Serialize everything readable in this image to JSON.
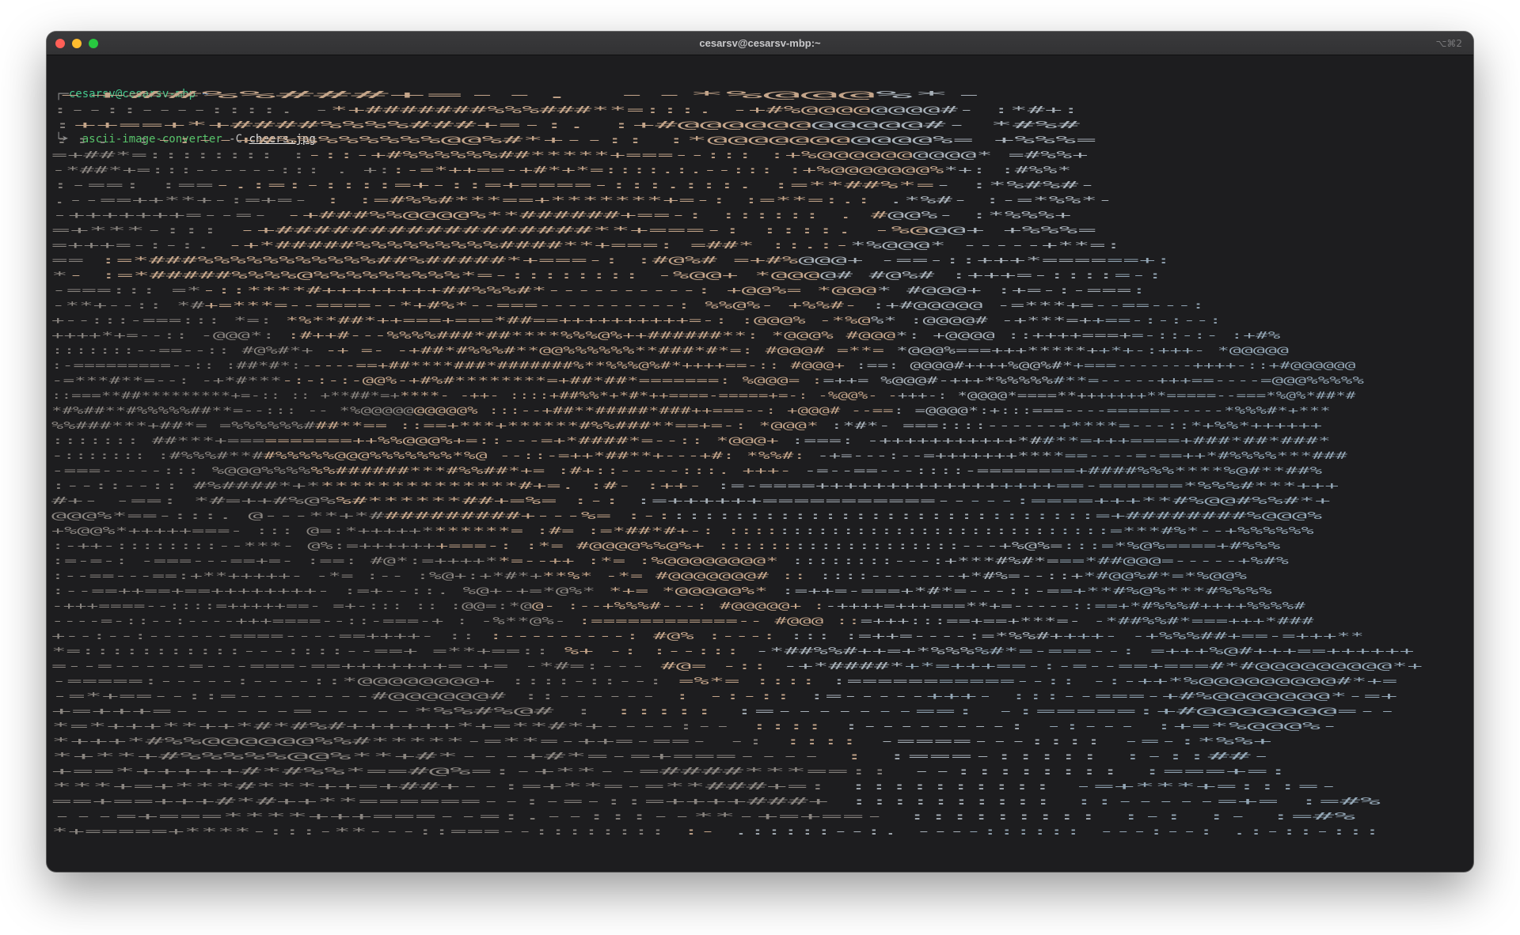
{
  "window": {
    "title": "cesarsv@cesarsv-mbp:~",
    "shortcut": "⌥⌘2"
  },
  "prompt": {
    "corner_top": "┌─",
    "user_host": "cesarsv@cesarsv-mbp",
    "path": "~",
    "corner_arrow": "└➤",
    "command": "ascii-image-converter",
    "flag": "-C",
    "argument": "cheers.jpg"
  },
  "ascii_output": {
    "lines": [
      "                                                     -+##%%###+=--.                                   --*%@@@%*-",
      ":--::----::::.                                    -*+#######%%%###**=:::.                            -+#%@@@@@@@@#-   :*#+:",
      "                                                  :++==+*+####%%%%###+=-:.                          :+#@@@@@@@@@@@#-   *#%#",
      "     ::.                                          :-:--+#%%%%%%%%@@%#*+--::                         :*@@@@@@@@@@@%=     +%%%=",
      "     =+##*=::::::::                               :-::-+#%%%%%%##*****+===--:::                     :+%@@@@@@@@@@*     =#%%+",
      "   -*##*+=:::------:::                      .    +::-=*++==-+#*+*=::::.:.--:::                    :+%@@@@@@@%*+:     :#%%*",
      "  :-==:                                         :==-.:=:-::::=+-::=+====-:::.:::.                   :=**##%*=-        :*%#%#-",
      " .--==++**+-:=+=-                                     :    :=#%%#***==+*******+=-:                 :=**=:.:  .*%#-     :-=*%%*-",
      " -+++++++=--=-                                         -+###%%@@@@%**######+==-:                   :::::: . #@@%-   :*%%%+",
      "=+***-:::                                              -+#################**+===-:                  ::::. -%@@@+        +%%%=",
      "=+++=-:-:.                                             -+*#####%%%%%%%%%####**+===:            =##*     ::.:-*%@@@*   -----+**=:",
      "                                                 ==   :=*###%%%%%%%%%%%##%#####*+===-:        :#@%#      =+#%@@@+   -==-::+++*======+:",
      "                                                  *-  :=*#####%%%%@%%%%%%%%%*=-::::::::       -%@@+      *@@@@#   #@%#  :+++=-::::=-:",
      "       -===:::                                   =*-::****#++++++++##%%%#*----------:         +@@%=      *@@@*    #@@@+  :+=-:-===:",
      "       -**+--::                                  *#+=***=--====--*+#%*--===----------:        %%@%-     +%%#-   :+#@@@@@   -=***+=--==---:",
      "+--:::-===:::                                *=:   *%**##*++===+===*##==++++++++++=-:         :@@@%      -*%@%*  :@@@@#    -+***=++==-:-:--:",
      "++++*+=--::                                -@@@*:  :#++#---%%%%###*##****%%%@%++######**:     *@@@%      #@@@*:   +@@@@ ::++++===+=-::-:-      :+#%",
      ":::::::--==--::                            #@%#*+   -+ =-   -+##*#%%%#**@@%%%%%%**###*#*=:    #@@@#      =**=    *@@@%===+++*****++*+-:+++-   *@@@@@",
      ":-=========--::                            :##*#*:-----==+##****###*#######%**%%%@%#*++++==-::    #@@@+      :==:  @@@@#++++%@@%#*+===-------++++-::+#@@@@@@",
      "  -=***#**=--:                              -+*#***-:-:-:-@@%-+#%#********=+##*##*=======:        %@@@=     :=++=  %@@@#-+++*%%%%%#**=-----+++==----=@@@%%%%%",
      " ::===**##*********+=-::              ::   +**##*=+****-  -++-  ::::+##%%*+*#*++====-=====+=-:     -%@@%-   -+++-:  *@@@@*====**+++++++**=====--===*%@%*##*#",
      "*#%##**#%%%%%##**=--:::               --    *%@@@@@@@@@@%      :::--+##**#####*###++===--:       +@@@#   --==:    =@@@@*:+:::===----======-----*%%%#*+***",
      "%%###***+##*=                              =%%%%%%###**==     ::==+***+******#%%###**==+=-:      *@@@*        :*#*-  ===::::------+****=---::*+%%*++++++",
      ":::::::                                   ##***+==========++%%@@@%+=::---=+*####*=--::          *@@@+        :===:  -+++++++++++*##**=+++====+###*##*###*",
      "       -:::::::                           :#%%%#**##%%%%%@@@%%%%%%%*%@  --::-=++*##**+---+#:     *%%#:        -+=---:--=+++++++****==----=-==++*#%%%%***###",
      "       -===-----:::                        %@@@%%%%%%######***#%%##*+=      :#+::-----:::.     +++-           -=--==---::::-========+####%%%****%@#**##%",
      "      :--::--::                           #%####*+***************#+=.       :#-                :++-           :=-====+++++++++++++++++==-======*%%%#***+++",
      "#+-                         -==:          *#=++#%@%%#******##+=%=                             :-:            :=++++++===========-----:====+++**#%@@#%%#*+",
      "@@@%*==-:::.                              @---**+*##########+---%=                                        :-:::::::::::::::::::::::::::::=+########%@@@%",
      "+%@@%*+++++===-                 :::      @=:*+++++*******=  :#=             :=*##*#+-:                   ::::::::::::::::::::::::::::::=***#%*--+%%%%%%",
      ":-++-::::::::--***-                      @%:=+++++++===-:   :*=             #@@@@%%@%+                 :::::::::::::::::::---+%@%=:::=*%@%====+#%%%",
      ":=-=-:         -===---==+=-     :==:     #@*:=++++**=--++   :*=             :%@@@@@@@@*                      ::::::::---:+***#%#*===*##@@@=-----+%#%",
      "     :--==---==:+**+++++-  -*=      :--  :%@+:+*#*+**%*     -*=              #@@@@@@@#           ::          ::::-------+*#%=--::+*#@@%#*=*%@@%",
      "  :--==++==+==++++++++-    :=+--::.      %@+-+=*@%*    *+=                 *@@@@@%*                          :=++=-===+*#*=---::-==+**#%@%***#%%%%",
      "   -+++====--::::=+++++==-   =+-:::    ::   :@@=:*@@-    :--+%%%#---:        #@@@@@+                        :-++++=+++===**+=-----::==+*#%%%#++++%%%%#",
      "----=-::--:----+++====--::-===-+  :     -%**@%-    :============--            #@@@                         ::=+++:::==+==+***=-      -*##%%#*===+++*###",
      "+--:--:------====----==++++-    ::                 :---------:              #@%                      :---:   :::  :=++=----:=*%%#++++-      -+%%%##+==-=+++**",
      "*=:::::::::::---::::--==+    =**+==::                                        %+                  -:   :--:::       -*##%%#++=+*%%%%#*=-===--:    =+++%@#+++==++++++",
      "=--=-----=---===-==+++++++=-+=   -*#=:---                                                       #@=    -::                -+*####*+*=+++==-:-=--==+===#*#@@@@@@@@@*+",
      "-=====:-----:----::*@@@@@@@@+   ::::-::--:                                                     =%*=  ::::                  :===========--::  -:-++*%@@@@@@@@@#*+=",
      "-=*+==--::=--------#@@@@@@#          ::------                                                  :   -:-::                   :=-----+++-    :::--===-+#%@@@@@@@*-=+",
      "+=+++=------=-----*%%#%@#              :                                                            :::::                  :=-------==:      -:=====:+#@@@@@@@=--",
      "*=*+++**++*#*#%#++++++*+=**#*+----:--                                                             ::::                 :--------:        -:---  :+=*%@@@%-",
      "*+++*#%%@@@@@@%%#*****-=**=-++=-==-   -:                                                        ::::                 -====---::::         -=-:*%%+",
      "*+**+#%%%%%@@%**+#*---+#*=-=+===----                                                              :                   :===-:::::           :-::##-",
      "+==*+++++#*#%%*==#@%=:-+**--=####***==::                                                                               --::::::::            :===+=:",
      "***+=+***#***++=+##+--:=+**=-=**###+=:                                                                               ::::::::::              -=+***+=:::=-",
      "==+==+++#*#++**======--:-=-::=++++###+                                                                                ::::::::::               ::-----=+=  :=#%",
      "---=+===****+++===--=:.--:::--**-+=+==-                                                                                :::::::::             :-:    :-  :=#%",
      "*+=====+****-:::-**---::===--::::::::                      :-                                                      .:::::--:.  ----::::::     ---:--: .:-::-:::"
    ]
  }
}
